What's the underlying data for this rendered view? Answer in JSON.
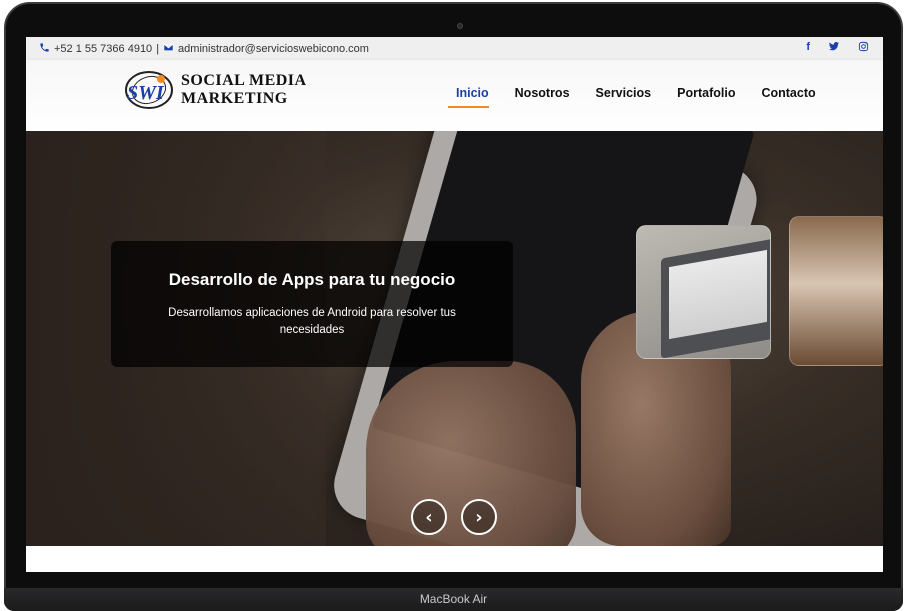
{
  "topbar": {
    "phone": "+52 1 55 7366 4910",
    "separator": "|",
    "email": "administrador@servicioswebicono.com",
    "socials": [
      "facebook-icon",
      "twitter-icon",
      "instagram-icon"
    ]
  },
  "brand": {
    "mark": "SWI",
    "line1": "SOCIAL MEDIA",
    "line2": "MARKETING"
  },
  "nav": {
    "items": [
      {
        "label": "Inicio",
        "active": true
      },
      {
        "label": "Nosotros",
        "active": false
      },
      {
        "label": "Servicios",
        "active": false
      },
      {
        "label": "Portafolio",
        "active": false
      },
      {
        "label": "Contacto",
        "active": false
      }
    ]
  },
  "hero": {
    "title": "Desarrollo de Apps para tu negocio",
    "description": "Desarrollamos aplicaciones de Android para resolver tus necesidades",
    "prev_icon": "‹",
    "next_icon": "›"
  },
  "device": {
    "label": "MacBook Air"
  },
  "colors": {
    "accent": "#1a3fa6",
    "underline": "#f08a24"
  }
}
